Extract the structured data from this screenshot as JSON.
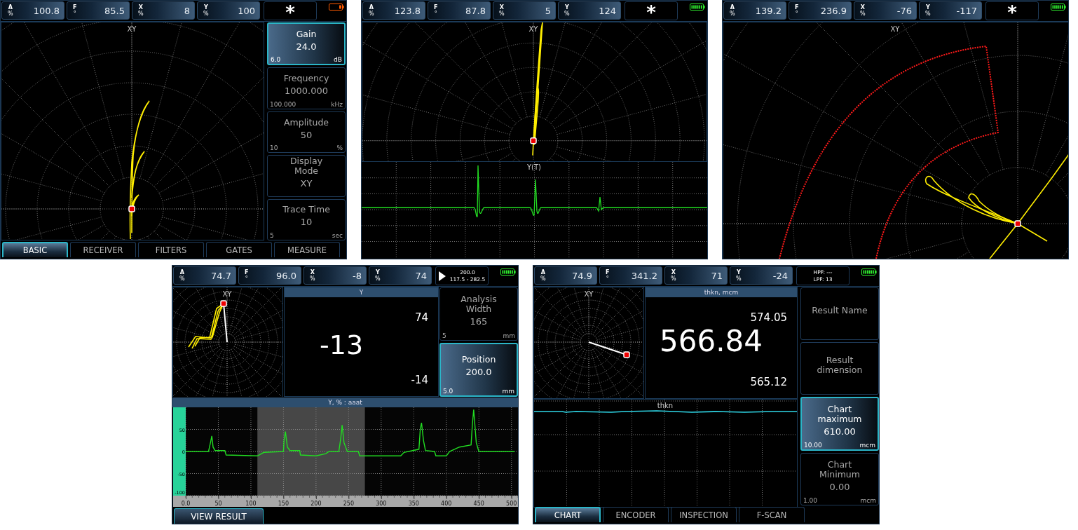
{
  "screens": [
    {
      "kind": "xy_menu",
      "readouts": [
        {
          "label": "A",
          "unit": "%",
          "value": "100.8"
        },
        {
          "label": "F",
          "unit": "°",
          "value": "85.5"
        },
        {
          "label": "X",
          "unit": "%",
          "value": "8"
        },
        {
          "label": "Y",
          "unit": "%",
          "value": "100"
        }
      ],
      "status": {
        "kind": "symbol",
        "lines": [
          "*"
        ]
      },
      "battery_low": true,
      "plot": {
        "title": "XY"
      },
      "params": [
        {
          "name": "Gain",
          "value": "24.0",
          "min": "6.0",
          "unit": "dB",
          "selected": true
        },
        {
          "name": "Frequency",
          "value": "1000.000",
          "min": "100.000",
          "unit": "kHz",
          "selected": false
        },
        {
          "name": "Amplitude",
          "value": "50",
          "min": "10",
          "unit": "%",
          "selected": false
        },
        {
          "name": "Display Mode",
          "value": "XY",
          "selected": false
        },
        {
          "name": "Trace Time",
          "value": "10",
          "min": "5",
          "unit": "sec",
          "selected": false
        }
      ],
      "tabs": [
        {
          "label": "BASIC",
          "selected": true
        },
        {
          "label": "RECEIVER",
          "selected": false
        },
        {
          "label": "FILTERS",
          "selected": false
        },
        {
          "label": "GATES",
          "selected": false
        },
        {
          "label": "MEASURE",
          "selected": false
        }
      ]
    },
    {
      "kind": "xy_trace",
      "readouts": [
        {
          "label": "A",
          "unit": "%",
          "value": "123.8"
        },
        {
          "label": "F",
          "unit": "°",
          "value": "87.8"
        },
        {
          "label": "X",
          "unit": "%",
          "value": "5"
        },
        {
          "label": "Y",
          "unit": "%",
          "value": "124"
        }
      ],
      "status": {
        "kind": "symbol",
        "lines": [
          "*"
        ]
      },
      "battery_low": false,
      "plot": {
        "title": "XY"
      },
      "trace": {
        "title": "Y(T)"
      }
    },
    {
      "kind": "xy_full",
      "readouts": [
        {
          "label": "A",
          "unit": "%",
          "value": "139.2"
        },
        {
          "label": "F",
          "unit": "°",
          "value": "236.9"
        },
        {
          "label": "X",
          "unit": "%",
          "value": "-76"
        },
        {
          "label": "Y",
          "unit": "%",
          "value": "-117"
        }
      ],
      "status": {
        "kind": "symbol",
        "lines": [
          "*"
        ]
      },
      "battery_low": false,
      "plot": {
        "title": "XY"
      }
    },
    {
      "kind": "analysis",
      "readouts": [
        {
          "label": "A",
          "unit": "%",
          "value": "74.7"
        },
        {
          "label": "F",
          "unit": "°",
          "value": "96.0"
        },
        {
          "label": "X",
          "unit": "%",
          "value": "-8"
        },
        {
          "label": "Y",
          "unit": "%",
          "value": "74"
        }
      ],
      "status": {
        "kind": "range",
        "lines": [
          "200.0",
          "117.5 - 282.5"
        ]
      },
      "battery_low": false,
      "plot": {
        "title": "XY"
      },
      "readout": {
        "title": "Y",
        "value": "-13",
        "max": "74",
        "min": "-14"
      },
      "params": [
        {
          "name": "Analysis Width",
          "value": "165",
          "min": "5",
          "unit": "mm",
          "selected": false
        },
        {
          "name": "Position",
          "value": "200.0",
          "min": "5.0",
          "unit": "mm",
          "selected": true
        }
      ],
      "chart": {
        "title": "Y, % : aaat",
        "chart_data": {
          "type": "line",
          "grid": true,
          "xlim": [
            0,
            510
          ],
          "ylim": [
            -100,
            100
          ],
          "xticks": [
            {
              "value": 0,
              "label": "0.0"
            },
            50,
            100,
            150,
            200,
            250,
            300,
            350,
            400,
            450,
            500
          ],
          "yticks": [
            -100,
            -50,
            0,
            50
          ],
          "x": [
            0,
            35,
            38,
            40,
            42,
            45,
            60,
            62,
            110,
            120,
            150,
            151,
            153,
            156,
            160,
            175,
            176,
            200,
            215,
            220,
            235,
            238,
            240,
            243,
            248,
            265,
            267,
            330,
            335,
            358,
            360,
            362,
            365,
            368,
            382,
            384,
            400,
            405,
            420,
            438,
            440,
            442,
            446,
            450,
            505
          ],
          "series": [
            {
              "color": "#22dd22",
              "values": [
                0,
                0,
                20,
                35,
                10,
                2,
                2,
                -8,
                -10,
                -2,
                0,
                25,
                45,
                10,
                2,
                2,
                -8,
                -10,
                -5,
                0,
                0,
                30,
                60,
                20,
                0,
                0,
                -10,
                -10,
                -2,
                5,
                50,
                65,
                25,
                2,
                0,
                -10,
                -10,
                0,
                10,
                15,
                60,
                95,
                20,
                0,
                0
              ]
            }
          ]
        }
      },
      "button": "VIEW RESULT"
    },
    {
      "kind": "result",
      "readouts": [
        {
          "label": "A",
          "unit": "%",
          "value": "74.9"
        },
        {
          "label": "F",
          "unit": "°",
          "value": "341.2"
        },
        {
          "label": "X",
          "unit": "%",
          "value": "71"
        },
        {
          "label": "Y",
          "unit": "%",
          "value": "-24"
        }
      ],
      "status": {
        "kind": "filters",
        "lines": [
          "HPF: ---",
          "LPF: 13"
        ]
      },
      "battery_low": false,
      "plot": {
        "title": "XY"
      },
      "readout": {
        "title": "thkn, mcm",
        "value": "566.84",
        "max": "574.05",
        "min": "565.12"
      },
      "params": [
        {
          "name": "Result Name",
          "selected": false
        },
        {
          "name": "Result dimension",
          "selected": false
        },
        {
          "name": "Chart maximum",
          "value": "610.00",
          "min": "10.00",
          "unit": "mcm",
          "selected": true
        },
        {
          "name": "Chart Minimum",
          "value": "0.00",
          "min": "1.00",
          "unit": "mcm",
          "selected": false
        }
      ],
      "strip": {
        "title": "thkn"
      },
      "tabs": [
        {
          "label": "CHART",
          "selected": true
        },
        {
          "label": "ENCODER",
          "selected": false
        },
        {
          "label": "INSPECTION",
          "selected": false
        },
        {
          "label": "F-SCAN",
          "selected": false
        }
      ]
    }
  ]
}
